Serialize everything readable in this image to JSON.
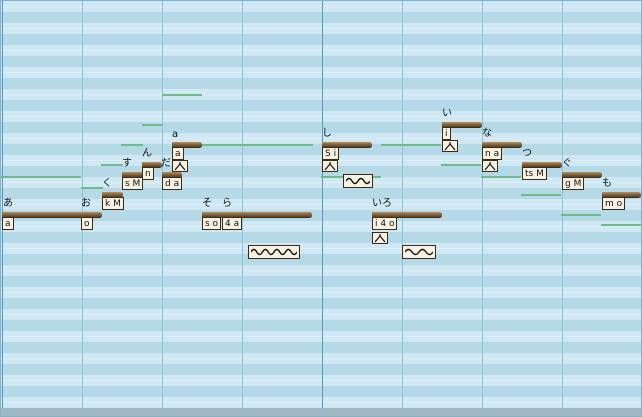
{
  "notes": [
    {
      "lyric": "あ",
      "phoneme": "a"
    },
    {
      "lyric": "お",
      "phoneme": "o"
    },
    {
      "lyric": "く",
      "phoneme": "k M"
    },
    {
      "lyric": "す",
      "phoneme": "s M"
    },
    {
      "lyric": "ん",
      "phoneme": "n"
    },
    {
      "lyric": "だ",
      "phoneme": "d a"
    },
    {
      "lyric": "a",
      "phoneme": "a"
    },
    {
      "lyric": "そ",
      "phoneme": "s o"
    },
    {
      "lyric": "ら",
      "phoneme": "4 a"
    },
    {
      "lyric": "し",
      "phoneme": "S i"
    },
    {
      "lyric": "い",
      "phoneme": "i"
    },
    {
      "lyric": "いろ",
      "phoneme": "i 4 o"
    },
    {
      "lyric": "な",
      "phoneme": "n a"
    },
    {
      "lyric": "つ",
      "phoneme": "ts M"
    },
    {
      "lyric": "ぐ",
      "phoneme": "g M"
    },
    {
      "lyric": "も",
      "phoneme": "m o"
    }
  ],
  "icons": {
    "accent": "accent-mark-icon",
    "vibrato": "vibrato-icon"
  },
  "colors": {
    "grid_light": "#cfe8f3",
    "grid_dark": "#b6d9e8",
    "bar_line": "#4a9fbf",
    "note_bar": "#7a5a34",
    "pitch_line": "#6fba8a",
    "label_bg": "#f6f1e2"
  }
}
